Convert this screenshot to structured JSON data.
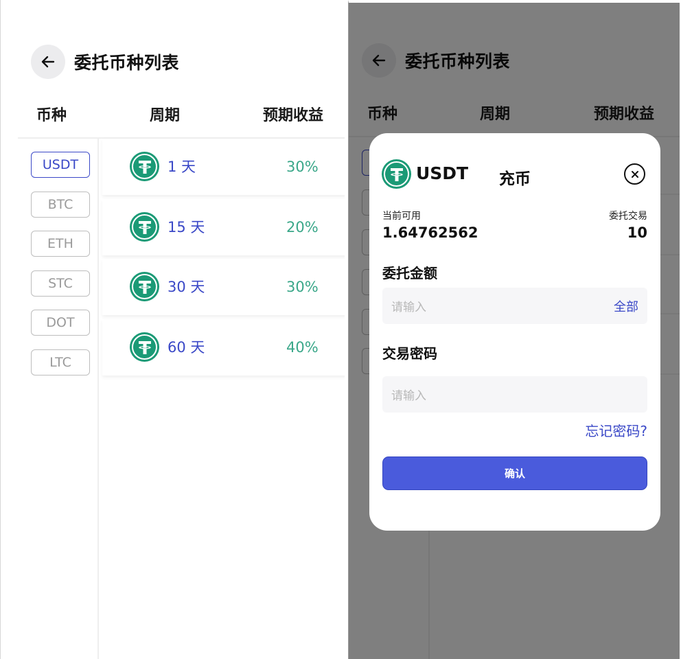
{
  "page": {
    "title": "委托币种列表",
    "columns": {
      "coin": "币种",
      "period": "周期",
      "yield": "预期收益"
    }
  },
  "colors": {
    "accent": "#3a48c7",
    "yield_green": "#3aa789",
    "tether_green": "#1b9a76",
    "button_blue": "#4a5bdc"
  },
  "icons": {
    "back": "arrow-left-icon",
    "coin": "tether-logo-icon",
    "close": "circle-x-icon"
  },
  "sidebar": {
    "coins": [
      {
        "label": "USDT",
        "active": true
      },
      {
        "label": "BTC",
        "active": false
      },
      {
        "label": "ETH",
        "active": false
      },
      {
        "label": "STC",
        "active": false
      },
      {
        "label": "DOT",
        "active": false
      },
      {
        "label": "LTC",
        "active": false
      }
    ]
  },
  "periods": [
    {
      "period": "1 天",
      "yield": "30%"
    },
    {
      "period": "15 天",
      "yield": "20%"
    },
    {
      "period": "30 天",
      "yield": "30%"
    },
    {
      "period": "60 天",
      "yield": "40%"
    }
  ],
  "modal": {
    "coin": "USDT",
    "title": "充币",
    "available_label": "当前可用",
    "available_value": "1.64762562",
    "entrust_label": "委托交易",
    "entrust_value": "10",
    "amount_label": "委托金额",
    "amount_placeholder": "请输入",
    "all_label": "全部",
    "password_label": "交易密码",
    "password_placeholder": "请输入",
    "forgot_label": "忘记密码?",
    "confirm_label": "确认"
  }
}
